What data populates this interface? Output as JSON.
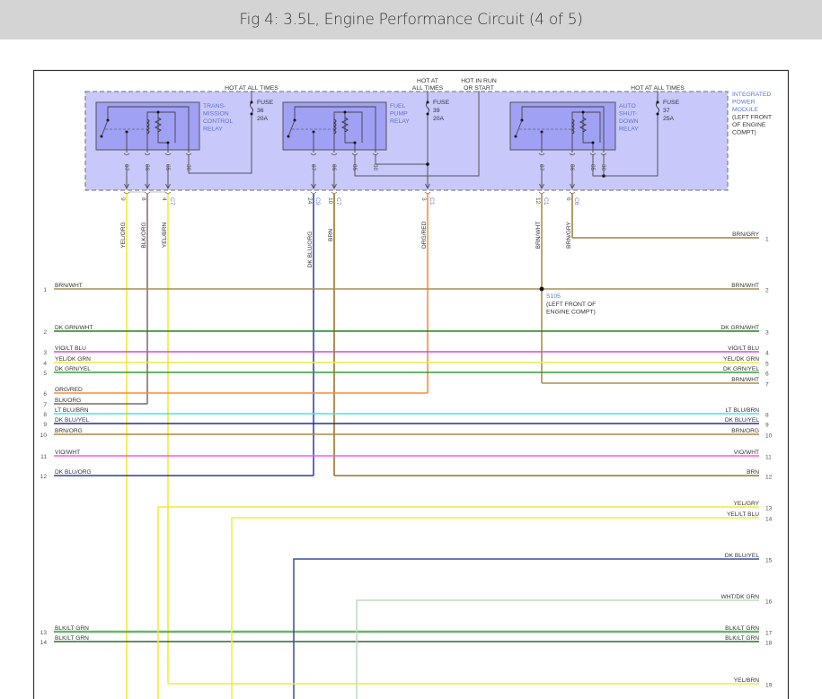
{
  "header": {
    "title": "Fig 4: 3.5L, Engine Performance Circuit (4 of 5)"
  },
  "module": {
    "name_lines": [
      "INTEGRATED",
      "POWER",
      "MODULE"
    ],
    "location_lines": [
      "(LEFT FRONT",
      "OF ENGINE",
      "COMPT)"
    ],
    "fill": "#c8c8fa"
  },
  "hot_in_run": [
    "HOT IN RUN",
    "OR START"
  ],
  "relays": [
    {
      "name_lines": [
        "TRANS-",
        "MISSION",
        "CONTROL",
        "RELAY"
      ],
      "pins": [
        "87",
        "86",
        "85",
        "30"
      ]
    },
    {
      "name_lines": [
        "FUEL",
        "PUMP",
        "RELAY"
      ],
      "pins": [
        "87",
        "86",
        "85",
        "30"
      ]
    },
    {
      "name_lines": [
        "AUTO",
        "SHUT-",
        "DOWN",
        "RELAY"
      ],
      "pins": [
        "87",
        "86",
        "85",
        "30"
      ]
    }
  ],
  "fuses": [
    {
      "label": "FUSE",
      "number": "36",
      "rating": "20A",
      "power_lines": [
        "HOT AT ALL TIMES"
      ]
    },
    {
      "label": "FUSE",
      "number": "39",
      "rating": "20A",
      "power_lines": [
        "HOT AT",
        "ALL TIMES"
      ]
    },
    {
      "label": "FUSE",
      "number": "37",
      "rating": "25A",
      "power_lines": [
        "HOT AT ALL TIMES"
      ]
    }
  ],
  "module_wires": [
    {
      "pin": "9",
      "connector": "",
      "color_name": "YEL/ORG",
      "color": "#f2ea3a"
    },
    {
      "pin": "8",
      "connector": "",
      "color_name": "BLK/ORG",
      "color": "#8a7068"
    },
    {
      "pin": "4",
      "connector": "C7",
      "color_name": "YEL/BRN",
      "color": "#f2ea3a"
    },
    {
      "pin": "24",
      "connector": "C9",
      "color_name": "DK BLU/ORG",
      "color": "#3a44a8"
    },
    {
      "pin": "10",
      "connector": "C7",
      "color_name": "BRN",
      "color": "#9a7420"
    },
    {
      "pin": "3",
      "connector": "C1",
      "color_name": "ORG/RED",
      "color": "#ff8a3a"
    },
    {
      "pin": "12",
      "connector": "C1",
      "color_name": "BRN/WHT",
      "color": "#a89050"
    },
    {
      "pin": "6",
      "connector": "C6",
      "color_name": "BRN/GRY",
      "color": "#a08040"
    }
  ],
  "left_circuits": [
    {
      "num": "1",
      "label": "BRN/WHT",
      "color": "#a89050"
    },
    {
      "num": "2",
      "label": "DK GRN/WHT",
      "color": "#1a8a1a"
    },
    {
      "num": "3",
      "label": "VIO/LT BLU",
      "color": "#d84ad8"
    },
    {
      "num": "4",
      "label": "YEL/DK GRN",
      "color": "#ecec44"
    },
    {
      "num": "5",
      "label": "DK GRN/YEL",
      "color": "#34a034"
    },
    {
      "num": "6",
      "label": "ORG/RED",
      "color": "#ff8a3a"
    },
    {
      "num": "7",
      "label": "BLK/ORG",
      "color": "#7a6a64"
    },
    {
      "num": "8",
      "label": "LT BLU/BRN",
      "color": "#48e4e0"
    },
    {
      "num": "9",
      "label": "DK BLU/YEL",
      "color": "#1a3298"
    },
    {
      "num": "10",
      "label": "BRN/ORG",
      "color": "#b08840"
    },
    {
      "num": "11",
      "label": "VIO/WHT",
      "color": "#ff52ff"
    },
    {
      "num": "12",
      "label": "DK BLU/ORG",
      "color": "#2a3ea0"
    },
    {
      "num": "13",
      "label": "BLK/LT GRN",
      "color": "#6ab46a"
    },
    {
      "num": "14",
      "label": "BLK/LT GRN",
      "color": "#2e6a2e"
    }
  ],
  "right_circuits": [
    {
      "num": "1",
      "label": "BRN/GRY",
      "color": "#a08040"
    },
    {
      "num": "2",
      "label": "BRN/WHT",
      "color": "#a89050"
    },
    {
      "num": "3",
      "label": "DK GRN/WHT",
      "color": "#1a8a1a"
    },
    {
      "num": "4",
      "label": "VIO/LT BLU",
      "color": "#d84ad8"
    },
    {
      "num": "5",
      "label": "YEL/DK GRN",
      "color": "#ecec44"
    },
    {
      "num": "6",
      "label": "DK GRN/YEL",
      "color": "#34a034"
    },
    {
      "num": "7",
      "label": "BRN/WHT",
      "color": "#a89050"
    },
    {
      "num": "8",
      "label": "LT BLU/BRN",
      "color": "#48e4e0"
    },
    {
      "num": "9",
      "label": "DK BLU/YEL",
      "color": "#1a3298"
    },
    {
      "num": "10",
      "label": "BRN/ORG",
      "color": "#b08840"
    },
    {
      "num": "11",
      "label": "VIO/WHT",
      "color": "#ff52ff"
    },
    {
      "num": "12",
      "label": "BRN",
      "color": "#9a7420"
    },
    {
      "num": "13",
      "label": "YEL/GRY",
      "color": "#f2ea3a"
    },
    {
      "num": "14",
      "label": "YEL/LT BLU",
      "color": "#eef03a"
    },
    {
      "num": "15",
      "label": "DK BLU/YEL",
      "color": "#3a4ea0"
    },
    {
      "num": "16",
      "label": "WHT/DK GRN",
      "color": "#bcdcbc"
    },
    {
      "num": "17",
      "label": "BLK/LT GRN",
      "color": "#6ab46a"
    },
    {
      "num": "18",
      "label": "BLK/LT GRN",
      "color": "#2e6a2e"
    },
    {
      "num": "19",
      "label": "YEL/BRN",
      "color": "#f2ea3a"
    }
  ],
  "splice": {
    "id": "S105",
    "location_lines": [
      "(LEFT FRONT OF",
      "ENGINE COMPT)"
    ]
  }
}
